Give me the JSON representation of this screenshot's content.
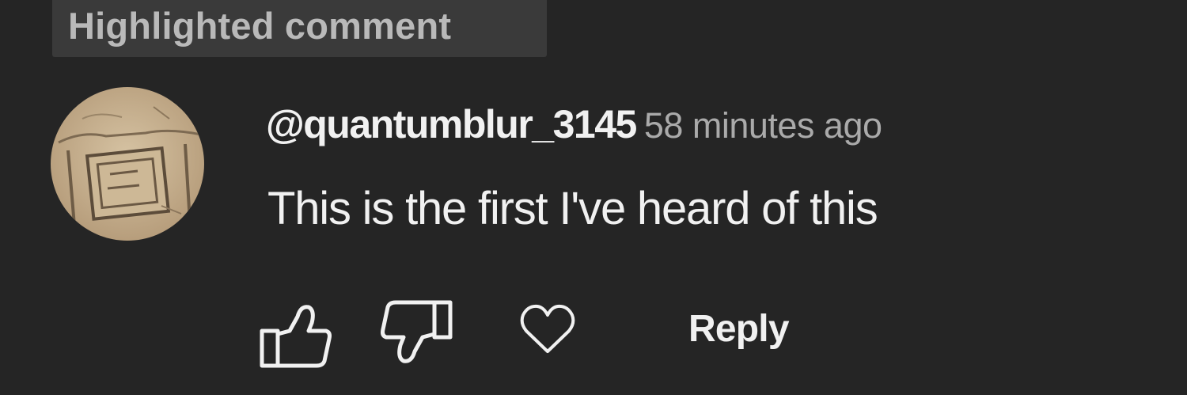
{
  "badge": {
    "label": "Highlighted comment"
  },
  "comment": {
    "author_handle": "@quantumblur_3145",
    "timestamp": "58 minutes ago",
    "text": "This is the first I've heard of this"
  },
  "actions": {
    "like_icon": "thumbs-up-icon",
    "dislike_icon": "thumbs-down-icon",
    "heart_icon": "heart-icon",
    "reply_label": "Reply"
  },
  "colors": {
    "background": "#252525",
    "badge_background": "#3a3a3a",
    "badge_text": "#b9b9b9",
    "primary_text": "#f1f1f1",
    "secondary_text": "#aaaaaa"
  }
}
